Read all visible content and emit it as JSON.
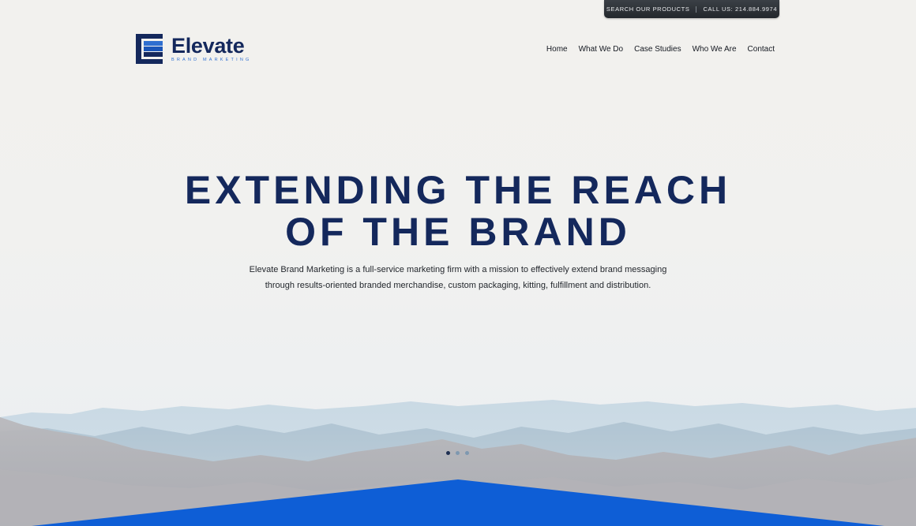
{
  "utility": {
    "search_label": "SEARCH OUR PRODUCTS",
    "call_label": "CALL US: 214.884.9974"
  },
  "logo": {
    "name": "Elevate",
    "tagline": "BRAND MARKETING",
    "icon": "elevate-e-icon"
  },
  "nav": {
    "items": [
      {
        "label": "Home"
      },
      {
        "label": "What We Do"
      },
      {
        "label": "Case Studies"
      },
      {
        "label": "Who We Are"
      },
      {
        "label": "Contact"
      }
    ]
  },
  "hero": {
    "title_line1": "EXTENDING THE REACH",
    "title_line2": "OF THE BRAND",
    "description": "Elevate Brand Marketing is a full-service marketing firm with a mission to effectively extend brand messaging through results-oriented branded merchandise, custom packaging, kitting, fulfillment and distribution."
  },
  "slider": {
    "count": 3,
    "active_index": 0
  },
  "colors": {
    "brand_navy": "#14285c",
    "brand_blue": "#2f6fd0",
    "accent_blue": "#0e5ed6"
  }
}
